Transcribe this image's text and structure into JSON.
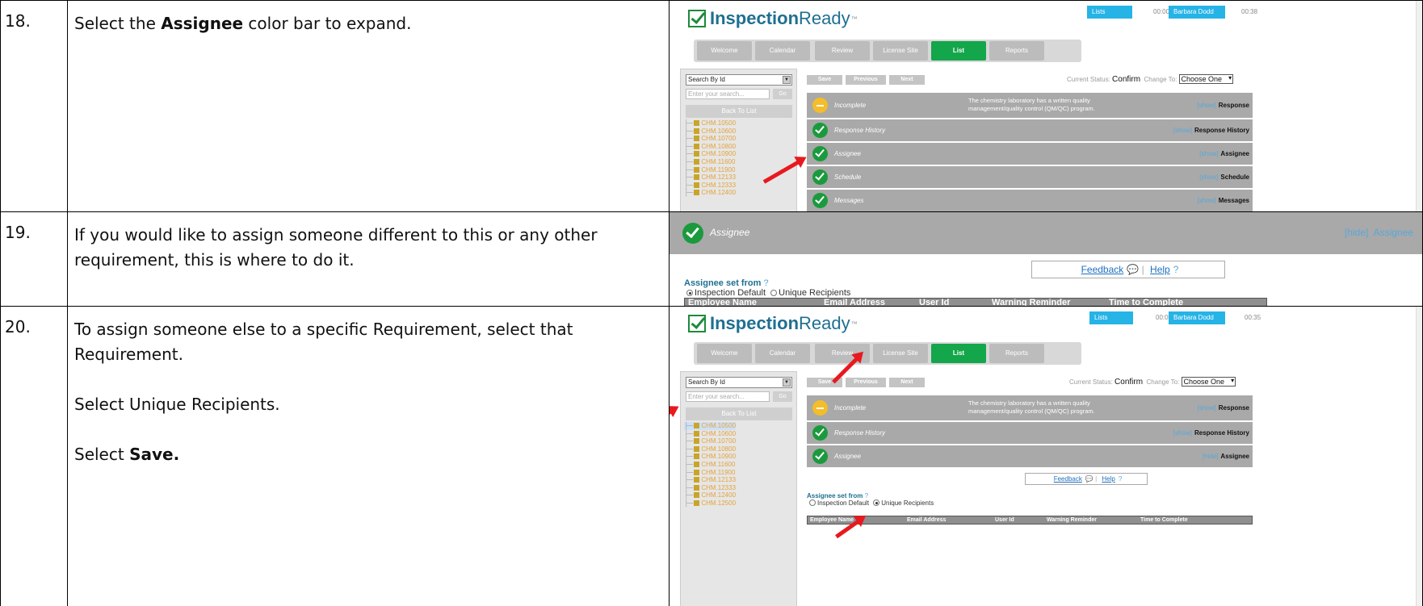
{
  "steps": [
    {
      "number": "18.",
      "text_before": "Select the ",
      "text_bold": "Assignee",
      "text_after": " color bar to expand."
    },
    {
      "number": "19.",
      "text": "If you would like to assign someone different to this or any other requirement, this is where to do it."
    },
    {
      "number": "20.",
      "line1": "To assign someone else to a specific Requirement, select that Requirement.",
      "line2": "Select Unique Recipients.",
      "line3_before": "Select ",
      "line3_bold": "Save."
    }
  ],
  "app": {
    "logo_bold": "Inspection",
    "logo_light": "Ready",
    "logo_tm": "™",
    "topbar_lists": "Lists",
    "topbar_timer1": "00:00",
    "topbar_user": "Barbara Dodd",
    "topbar_timer2_a": "00:38",
    "topbar_timer2_b": "00:35",
    "tabs": [
      "Welcome",
      "Calendar",
      "Review",
      "License Site",
      "List",
      "Reports"
    ],
    "search_select": "Search By Id",
    "search_placeholder": "Enter your search...",
    "go_label": "Go",
    "back_to_list": "Back To List",
    "tree_items": [
      "CHM.10500",
      "CHM.10600",
      "CHM.10700",
      "CHM.10800",
      "CHM.10900",
      "CHM.11600",
      "CHM.11900",
      "CHM.12133",
      "CHM.12333",
      "CHM.12400",
      "CHM.12500"
    ],
    "btn_save": "Save",
    "btn_previous": "Previous",
    "btn_next": "Next",
    "status_label": "Current Status:",
    "status_value": "Confirm",
    "change_to_label": "Change To:",
    "change_to_value": "Choose One",
    "bars": [
      {
        "label": "Incomplete",
        "right": "Response",
        "toggle": "[show]"
      },
      {
        "label": "Response History",
        "right": "Response History",
        "toggle": "[show]"
      },
      {
        "label": "Assignee",
        "right": "Assignee",
        "toggle": "[show]"
      },
      {
        "label": "Schedule",
        "right": "Schedule",
        "toggle": "[show]"
      },
      {
        "label": "Messages",
        "right": "Messages",
        "toggle": "[show]"
      }
    ],
    "requirement_text": "The chemistry laboratory has a written quality management/quality control (QM/QC) program.",
    "hide_toggle": "[hide]",
    "feedback": "Feedback",
    "help": "Help",
    "assignee_set_from": "Assignee set from",
    "q_mark": "?",
    "radio_default": "Inspection Default",
    "radio_unique": "Unique Recipients",
    "columns": [
      "Employee Name",
      "Email Address",
      "User Id",
      "Warning Reminder",
      "Time to Complete"
    ],
    "accent_green": "#13a64a",
    "accent_blue": "#26b3e6",
    "arrow_red": "#e8191e"
  }
}
